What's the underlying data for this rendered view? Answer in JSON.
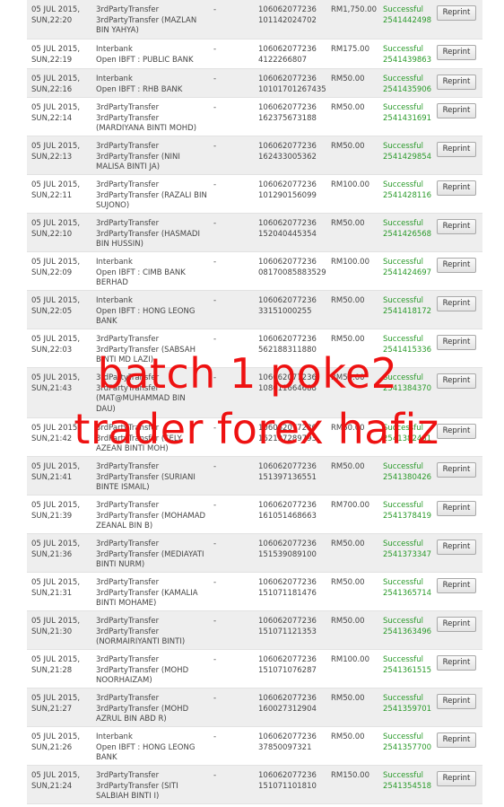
{
  "overlay": {
    "line1": "batch 1 poke2",
    "line2": "trader forex hafiz"
  },
  "colors": {
    "status": "#2a9a2a",
    "overlay_text": "#ee1111",
    "row_alt": "#eeeeee"
  },
  "transactions": [
    {
      "date": "05 JUL 2015,\nSUN,22:20",
      "desc": "3rdPartyTransfer\n3rdPartyTransfer (MAZLAN\nBIN YAHYA)",
      "dash": "-",
      "acct": "106062077236\n101142024702",
      "amount": "RM1,750.00",
      "status": "Successful\n2541442498",
      "button": "Reprint"
    },
    {
      "date": "05 JUL 2015,\nSUN,22:19",
      "desc": "Interbank\nOpen IBFT : PUBLIC BANK",
      "dash": "-",
      "acct": "106062077236\n4122266807",
      "amount": "RM175.00",
      "status": "Successful\n2541439863",
      "button": "Reprint"
    },
    {
      "date": "05 JUL 2015,\nSUN,22:16",
      "desc": "Interbank\nOpen IBFT : RHB BANK",
      "dash": "-",
      "acct": "106062077236\n10101701267435",
      "amount": "RM50.00",
      "status": "Successful\n2541435906",
      "button": "Reprint"
    },
    {
      "date": "05 JUL 2015,\nSUN,22:14",
      "desc": "3rdPartyTransfer\n3rdPartyTransfer\n(MARDIYANA BINTI MOHD)",
      "dash": "-",
      "acct": "106062077236\n162375673188",
      "amount": "RM50.00",
      "status": "Successful\n2541431691",
      "button": "Reprint"
    },
    {
      "date": "05 JUL 2015,\nSUN,22:13",
      "desc": "3rdPartyTransfer\n3rdPartyTransfer (NINI\nMALISA BINTI JA)",
      "dash": "-",
      "acct": "106062077236\n162433005362",
      "amount": "RM50.00",
      "status": "Successful\n2541429854",
      "button": "Reprint"
    },
    {
      "date": "05 JUL 2015,\nSUN,22:11",
      "desc": "3rdPartyTransfer\n3rdPartyTransfer (RAZALI BIN\nSUJONO)",
      "dash": "-",
      "acct": "106062077236\n101290156099",
      "amount": "RM100.00",
      "status": "Successful\n2541428116",
      "button": "Reprint"
    },
    {
      "date": "05 JUL 2015,\nSUN,22:10",
      "desc": "3rdPartyTransfer\n3rdPartyTransfer (HASMADI\nBIN HUSSIN)",
      "dash": "-",
      "acct": "106062077236\n152040445354",
      "amount": "RM50.00",
      "status": "Successful\n2541426568",
      "button": "Reprint"
    },
    {
      "date": "05 JUL 2015,\nSUN,22:09",
      "desc": "Interbank\nOpen IBFT : CIMB BANK\nBERHAD",
      "dash": "-",
      "acct": "106062077236\n08170085883529",
      "amount": "RM100.00",
      "status": "Successful\n2541424697",
      "button": "Reprint"
    },
    {
      "date": "05 JUL 2015,\nSUN,22:05",
      "desc": "Interbank\nOpen IBFT : HONG LEONG\nBANK",
      "dash": "-",
      "acct": "106062077236\n33151000255",
      "amount": "RM50.00",
      "status": "Successful\n2541418172",
      "button": "Reprint"
    },
    {
      "date": "05 JUL 2015,\nSUN,22:03",
      "desc": "3rdPartyTransfer\n3rdPartyTransfer (SABSAH\nBINTI MD LAZI)",
      "dash": "-",
      "acct": "106062077236\n562188311880",
      "amount": "RM50.00",
      "status": "Successful\n2541415336",
      "button": "Reprint"
    },
    {
      "date": "05 JUL 2015,\nSUN,21:43",
      "desc": "3rdPartyTransfer\n3rdPartyTransfer\n(MAT@MUHAMMAD BIN\nDAU)",
      "dash": "-",
      "acct": "106062077236\n108011664688",
      "amount": "RM50.00",
      "status": "Successful\n2541384370",
      "button": "Reprint"
    },
    {
      "date": "05 JUL 2015,\nSUN,21:42",
      "desc": "3rdPartyTransfer\n3rdPartyTransfer (SELY\nAZEAN BINTI MOH)",
      "dash": "-",
      "acct": "106062077236\n162197289793",
      "amount": "RM50.00",
      "status": "Successful\n2541382461",
      "button": "Reprint"
    },
    {
      "date": "05 JUL 2015,\nSUN,21:41",
      "desc": "3rdPartyTransfer\n3rdPartyTransfer (SURIANI\nBINTE ISMAIL)",
      "dash": "-",
      "acct": "106062077236\n151397136551",
      "amount": "RM50.00",
      "status": "Successful\n2541380426",
      "button": "Reprint"
    },
    {
      "date": "05 JUL 2015,\nSUN,21:39",
      "desc": "3rdPartyTransfer\n3rdPartyTransfer (MOHAMAD\nZEANAL BIN B)",
      "dash": "-",
      "acct": "106062077236\n161051468663",
      "amount": "RM700.00",
      "status": "Successful\n2541378419",
      "button": "Reprint"
    },
    {
      "date": "05 JUL 2015,\nSUN,21:36",
      "desc": "3rdPartyTransfer\n3rdPartyTransfer (MEDIAYATI\nBINTI NURM)",
      "dash": "-",
      "acct": "106062077236\n151539089100",
      "amount": "RM50.00",
      "status": "Successful\n2541373347",
      "button": "Reprint"
    },
    {
      "date": "05 JUL 2015,\nSUN,21:31",
      "desc": "3rdPartyTransfer\n3rdPartyTransfer (KAMALIA\nBINTI MOHAME)",
      "dash": "-",
      "acct": "106062077236\n151071181476",
      "amount": "RM50.00",
      "status": "Successful\n2541365714",
      "button": "Reprint"
    },
    {
      "date": "05 JUL 2015,\nSUN,21:30",
      "desc": "3rdPartyTransfer\n3rdPartyTransfer\n(NORMAIRIYANTI BINTI)",
      "dash": "-",
      "acct": "106062077236\n151071121353",
      "amount": "RM50.00",
      "status": "Successful\n2541363496",
      "button": "Reprint"
    },
    {
      "date": "05 JUL 2015,\nSUN,21:28",
      "desc": "3rdPartyTransfer\n3rdPartyTransfer (MOHD\nNOORHAIZAM)",
      "dash": "-",
      "acct": "106062077236\n151071076287",
      "amount": "RM100.00",
      "status": "Successful\n2541361515",
      "button": "Reprint"
    },
    {
      "date": "05 JUL 2015,\nSUN,21:27",
      "desc": "3rdPartyTransfer\n3rdPartyTransfer (MOHD\nAZRUL BIN ABD R)",
      "dash": "-",
      "acct": "106062077236\n160027312904",
      "amount": "RM50.00",
      "status": "Successful\n2541359701",
      "button": "Reprint"
    },
    {
      "date": "05 JUL 2015,\nSUN,21:26",
      "desc": "Interbank\nOpen IBFT : HONG LEONG\nBANK",
      "dash": "-",
      "acct": "106062077236\n37850097321",
      "amount": "RM50.00",
      "status": "Successful\n2541357700",
      "button": "Reprint"
    },
    {
      "date": "05 JUL 2015,\nSUN,21:24",
      "desc": "3rdPartyTransfer\n3rdPartyTransfer (SITI\nSALBIAH BINTI I)",
      "dash": "-",
      "acct": "106062077236\n151071101810",
      "amount": "RM150.00",
      "status": "Successful\n2541354518",
      "button": "Reprint"
    }
  ]
}
